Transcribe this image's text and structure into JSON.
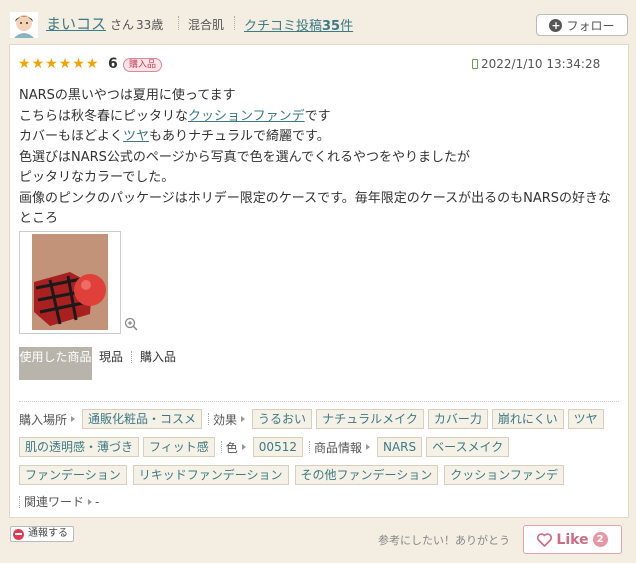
{
  "header": {
    "username": "まいコス",
    "honorific": "さん",
    "age": "33歳",
    "skin_type": "混合肌",
    "review_count_prefix": "クチコミ投稿",
    "review_count": "35",
    "review_count_suffix": "件",
    "follow_label": "フォロー"
  },
  "review": {
    "stars": 6,
    "rating": "6",
    "purchase_badge": "購入品",
    "date": "2022/1/10 13:34:28",
    "lines": {
      "l1": "NARSの黒いやつは夏用に使ってます",
      "l2a": "こちらは秋冬春にピッタリな",
      "l2_link": "クッションファンデ",
      "l2b": "です",
      "l3a": "カバーもほどよく",
      "l3_link": "ツヤ",
      "l3b": "もありナチュラルで綺麗です。",
      "l4": "色選びはNARS公式のページから写真で色を選んでくれるやつをやりましたが",
      "l5": "ピッタリなカラーでした。",
      "l6": "画像のピンクのパッケージはホリデー限定のケースです。毎年限定のケースが出るのもNARSの好きなところ"
    },
    "used_label": "使用した商品",
    "used_items": [
      "現品",
      "購入品"
    ]
  },
  "tags": {
    "purchase_place_label": "購入場所",
    "purchase_place": [
      "通販化粧品・コスメ"
    ],
    "effect_label": "効果",
    "effects": [
      "うるおい",
      "ナチュラルメイク",
      "カバー力",
      "崩れにくい",
      "ツヤ",
      "肌の透明感・薄づき",
      "フィット感"
    ],
    "color_label": "色",
    "colors": [
      "00512"
    ],
    "product_info_label": "商品情報",
    "product_info": [
      "NARS",
      "ベースメイク",
      "ファンデーション",
      "リキッドファンデーション",
      "その他ファンデーション",
      "クッションファンデ"
    ],
    "related_label": "関連ワード",
    "related_value": "-"
  },
  "footer": {
    "report_label": "通報する",
    "helpful_text": "参考にしたい！ありがとう",
    "like_label": "Like",
    "like_count": "2"
  },
  "colors": {
    "background": "#f4ede2",
    "link": "#3d7a85",
    "star": "#f2a400",
    "like": "#d06a83"
  }
}
